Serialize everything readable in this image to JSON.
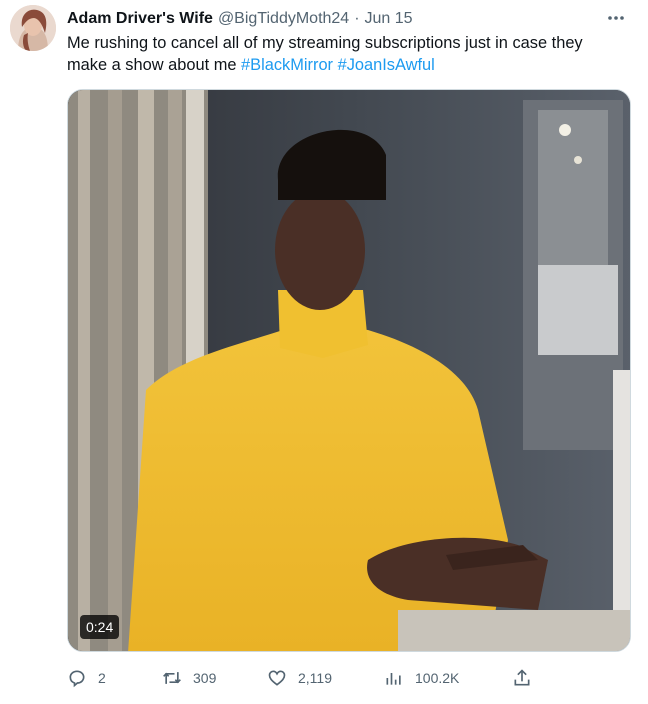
{
  "tweet": {
    "author_name": "Adam Driver's Wife",
    "handle": "@BigTiddyMoth24",
    "separator": "·",
    "date": "Jun 15",
    "text_plain": "Me rushing to cancel all of my streaming subscriptions just in case they make a show about me",
    "hashtags": [
      "#BlackMirror",
      "#JoanIsAwful"
    ],
    "media": {
      "duration": "0:24"
    },
    "stats": {
      "replies": "2",
      "retweets": "309",
      "likes": "2,119",
      "views": "100.2K"
    }
  },
  "colors": {
    "text": "#0f1419",
    "secondary": "#536471",
    "link": "#1d9bf0",
    "border": "#cfd9de"
  },
  "icons": {
    "more": "more-horizontal-icon",
    "reply": "reply-bubble-icon",
    "retweet": "retweet-icon",
    "like": "heart-icon",
    "views": "views-bar-chart-icon",
    "share": "share-upload-icon"
  }
}
